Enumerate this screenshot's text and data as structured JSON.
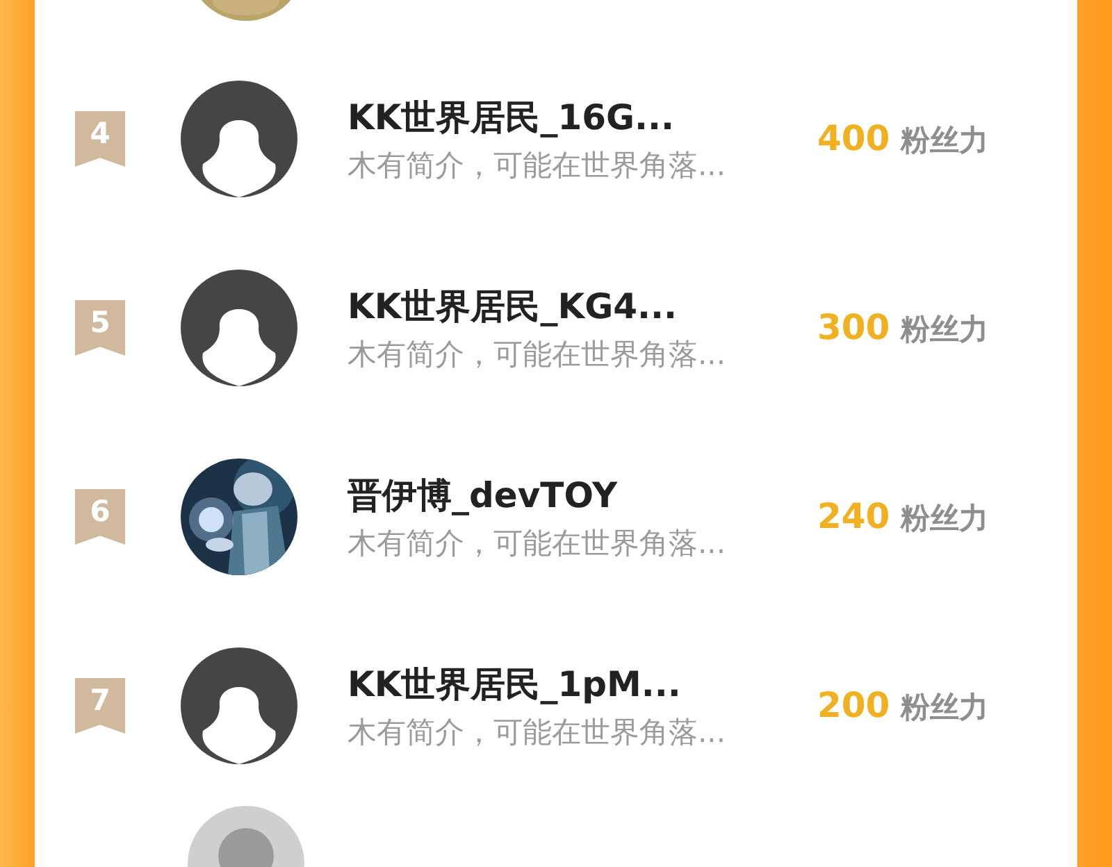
{
  "ranking": [
    {
      "rank": "4",
      "name": "KK世界居民_16G...",
      "bio": "木有简介，可能在世界角落...",
      "count": "400",
      "unit": "粉丝力",
      "avatar": {
        "kind": "default"
      }
    },
    {
      "rank": "5",
      "name": "KK世界居民_KG4...",
      "bio": "木有简介，可能在世界角落...",
      "count": "300",
      "unit": "粉丝力",
      "avatar": {
        "kind": "default"
      }
    },
    {
      "rank": "6",
      "name": "晋伊博_devTOY",
      "bio": "木有简介，可能在世界角落...",
      "count": "240",
      "unit": "粉丝力"
    },
    {
      "rank": "7",
      "name": "KK世界居民_1pM...",
      "bio": "木有简介，可能在世界角落...",
      "count": "200",
      "unit": "粉丝力",
      "avatar": {
        "kind": "default"
      }
    }
  ]
}
